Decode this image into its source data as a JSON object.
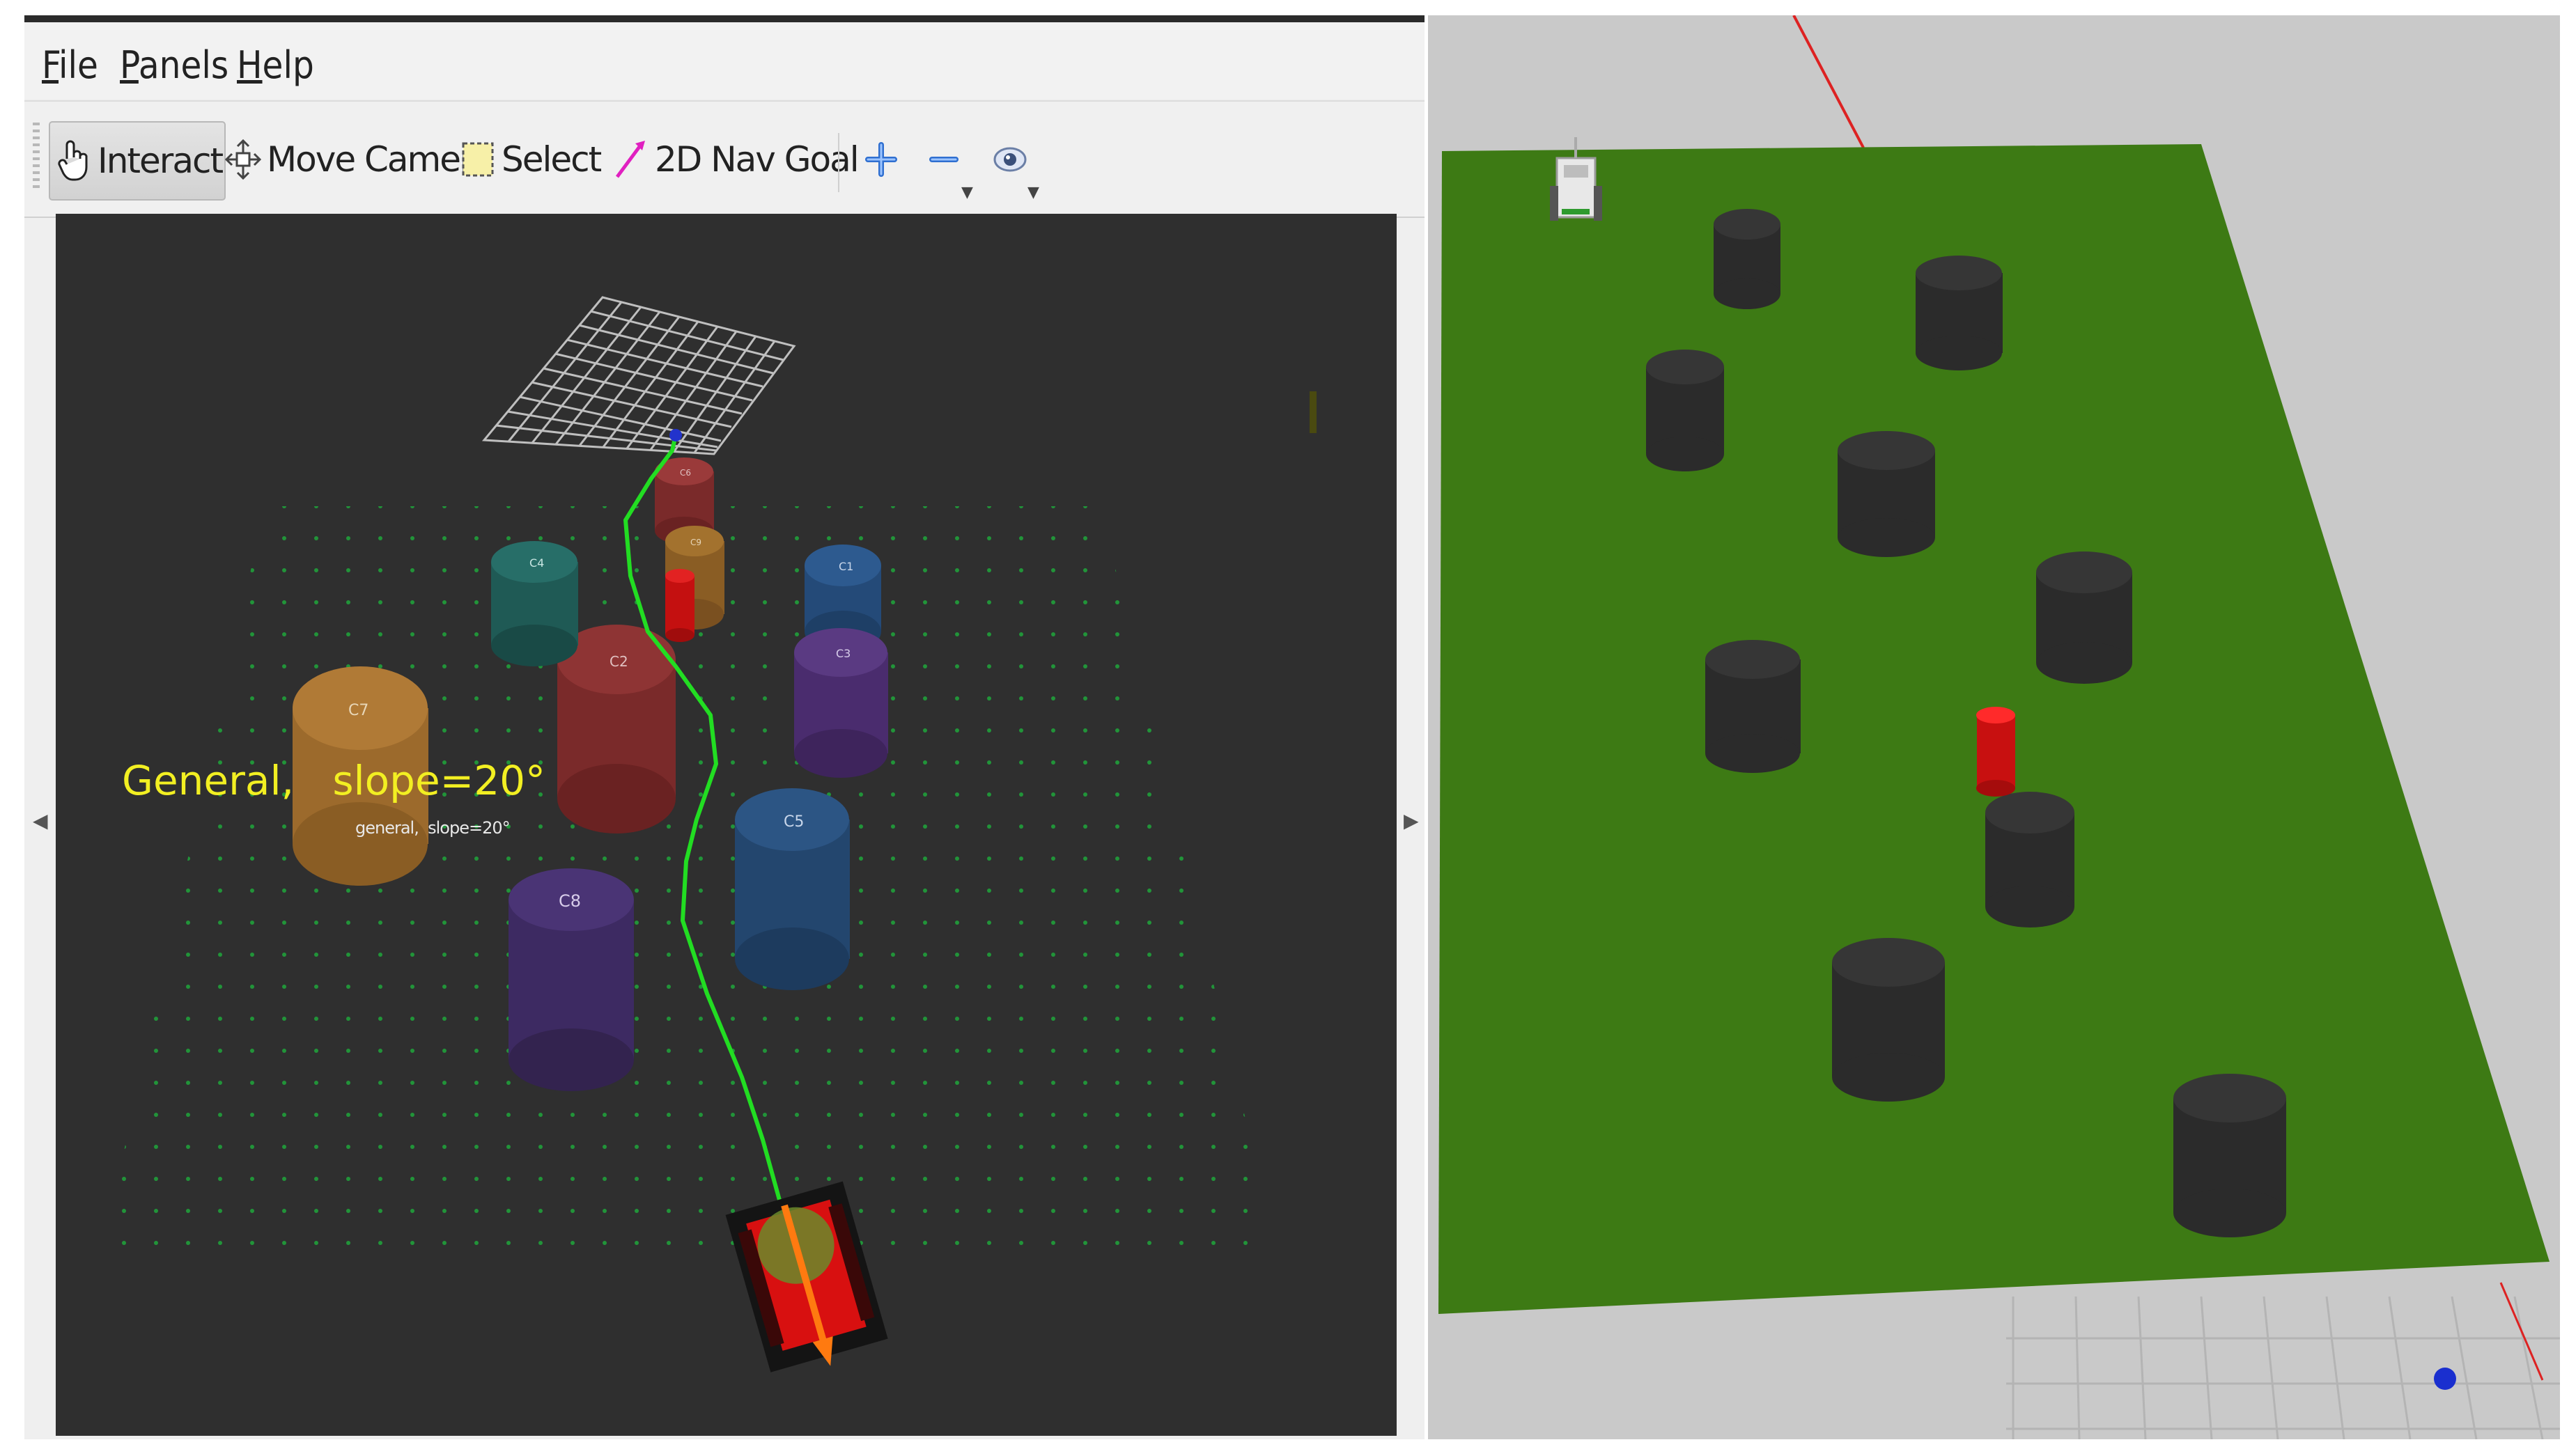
{
  "menubar": {
    "items": [
      {
        "mnemonic": "F",
        "rest": "ile"
      },
      {
        "mnemonic": "P",
        "rest": "anels"
      },
      {
        "mnemonic": "H",
        "rest": "elp"
      }
    ]
  },
  "toolbar": {
    "interact_label": "Interact",
    "move_camera_label": "Move Camera",
    "select_label": "Select",
    "nav_goal_label": "2D Nav Goal",
    "active_tool": "Interact",
    "icons": [
      "hand-pointer-icon",
      "move-camera-icon",
      "select-box-icon",
      "nav-goal-arrow-icon",
      "plus-icon",
      "minus-icon",
      "eye-camera-icon"
    ]
  },
  "viewport": {
    "overlay_label": "General,   slope=20°",
    "overlay_small_label": "general,  slope=20°",
    "obstacles": [
      {
        "label": "C7"
      },
      {
        "label": "C2"
      },
      {
        "label": "C5"
      },
      {
        "label": "C8"
      },
      {
        "label": "C1"
      },
      {
        "label": "C3"
      },
      {
        "label": "C4"
      },
      {
        "label": "C6"
      },
      {
        "label": "C9"
      }
    ],
    "colors": {
      "background": "#2f2f2f",
      "path": "#22dd22",
      "grid_dots": "#1f9f3a",
      "text_overlay": "#f2ef22"
    }
  },
  "gazebo": {
    "colors": {
      "ground": "#3d7a14",
      "floor": "#c9c9c9",
      "obstacle": "#2b2b2b",
      "goal_marker": "#dd1111",
      "axis_line": "#dd2222"
    }
  }
}
